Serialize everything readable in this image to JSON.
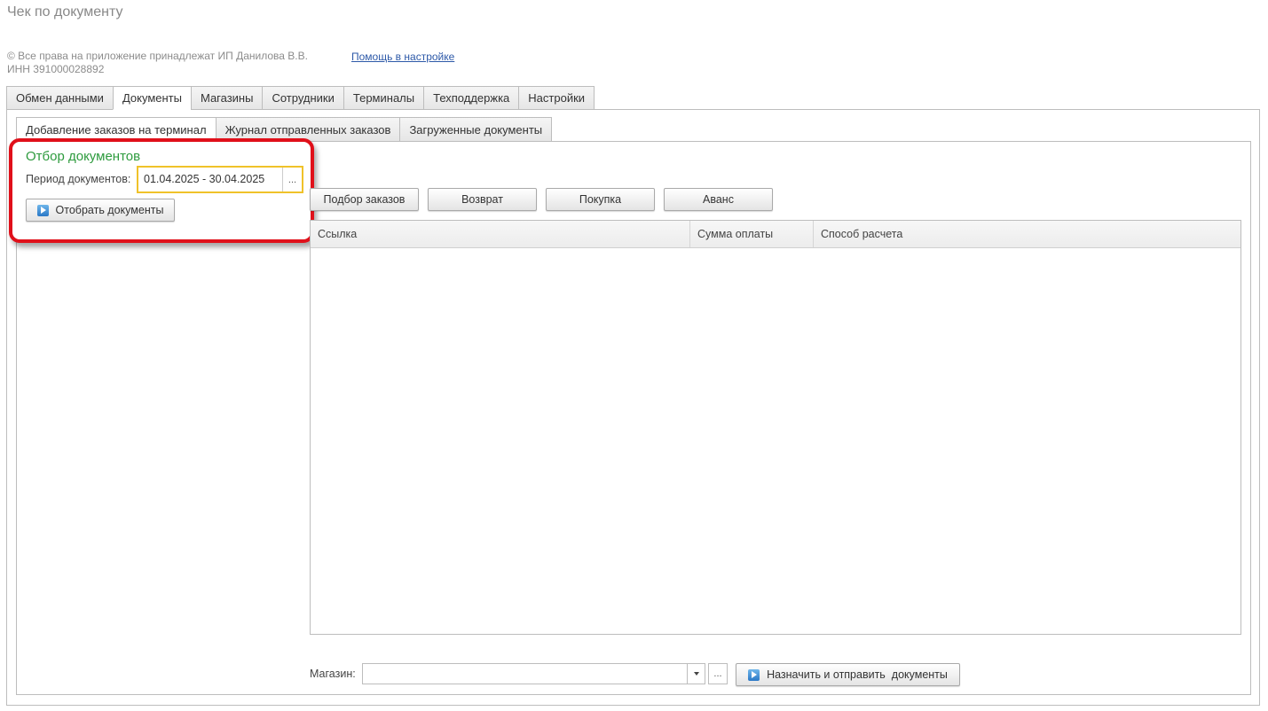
{
  "header": {
    "title": "Чек по документу",
    "copyright_line1": "© Все права на приложение принадлежат ИП Данилова В.В.",
    "copyright_line2": "ИНН 391000028892",
    "help_link": "Помощь в настройке"
  },
  "main_tabs": [
    {
      "label": "Обмен данными"
    },
    {
      "label": "Документы",
      "active": true
    },
    {
      "label": "Магазины"
    },
    {
      "label": "Сотрудники"
    },
    {
      "label": "Терминалы"
    },
    {
      "label": "Техподдержка"
    },
    {
      "label": "Настройки"
    }
  ],
  "sub_tabs": [
    {
      "label": "Добавление заказов на терминал",
      "active": true
    },
    {
      "label": "Журнал отправленных заказов"
    },
    {
      "label": "Загруженные документы"
    }
  ],
  "filter": {
    "title": "Отбор документов",
    "period_label": "Период документов:",
    "period_value": "01.04.2025 - 30.04.2025",
    "period_button": "...",
    "select_button": "Отобрать документы"
  },
  "toolbar": {
    "pick_orders": "Подбор заказов",
    "return": "Возврат",
    "purchase": "Покупка",
    "advance": "Аванс"
  },
  "table": {
    "columns": [
      "Ссылка",
      "Сумма оплаты",
      "Способ расчета"
    ],
    "rows": []
  },
  "footer": {
    "shop_label": "Магазин:",
    "shop_value": "",
    "shop_more": "...",
    "submit_button": "Назначить и отправить  документы"
  },
  "colors": {
    "filter_title": "#2e9b3e",
    "highlight_border": "#e0101a",
    "field_focus": "#f0c22a",
    "link": "#2d59a8"
  }
}
